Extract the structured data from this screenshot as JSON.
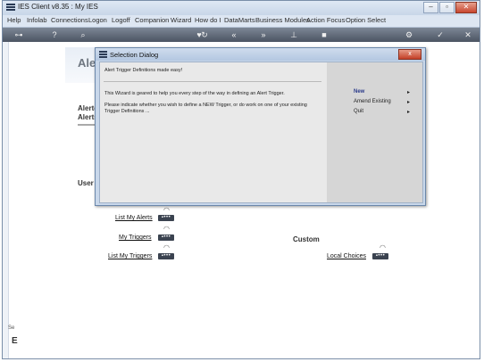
{
  "window": {
    "title": "IES Client v8.35 : My IES"
  },
  "menu": [
    "Help",
    "Infolab",
    "Connections",
    "Logon",
    "Logoff",
    "Companion",
    "Wizard",
    "How do I",
    "DataMarts",
    "Business Modules",
    "Action Focus",
    "Option Select"
  ],
  "background": {
    "heading": "Alert",
    "alerts_label": "Alerter",
    "alerts_label2": "Alerts",
    "user_label": "User O",
    "custom_label": "Custom",
    "links": {
      "list_my_alerts": "List My Alerts",
      "my_triggers": "My Triggers",
      "list_my_triggers": "List My Triggers",
      "local_choices": "Local Choices"
    },
    "status_frag": "Se",
    "status_frag2": "E"
  },
  "dialog": {
    "title": "Selection Dialog",
    "close_label": "x",
    "heading_text": "Alert Trigger Definitions made easy!",
    "para1": "This Wizard is geared to help you every step of the way in defining an Alert Trigger.",
    "para2": "Please indicate whether you wish to define a NEW Trigger, or do work on one of your existing Trigger Definitions ...",
    "options": [
      {
        "label": "New",
        "selected": true
      },
      {
        "label": "Amend Existing",
        "selected": false
      },
      {
        "label": "Quit",
        "selected": false
      }
    ],
    "arrow_glyph": "▸"
  },
  "colors": {
    "toolbar": "#5a6372",
    "dialog_accent": "#2a3a8a",
    "close": "#c8462f"
  }
}
